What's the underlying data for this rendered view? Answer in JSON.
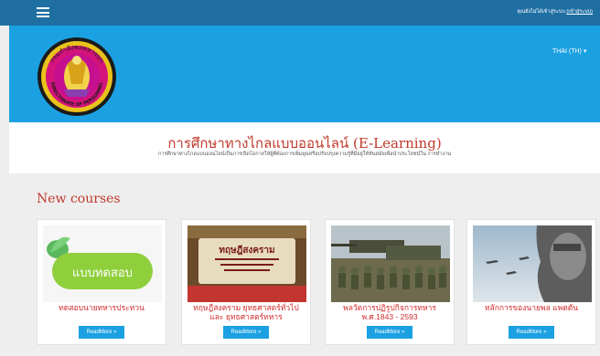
{
  "topbar": {
    "note": "คุณยังไม่ได้เข้าสู่ระบบ",
    "login_link": "(เข้าสู่ระบบ)"
  },
  "header": {
    "language": "THAI (TH) ▾",
    "logo_top_text": "กรมกำลังพลทหารบก",
    "logo_bottom_text": "DIRECTORATE OF PERSONNEL"
  },
  "banner": {
    "title": "การศึกษาทางไกลแบบออนไลน์ (E-Learning)",
    "subtitle": "การศึกษาทางไกลแบบออนไลน์เป็นการเปิดโอกาสให้ผู้ที่ต้องการเพิ่มพูนหรือปรับปรุงความรู้ที่มีอยู่ให้ทันสมัยเพื่อนำประโยชน์ใน การทำงาน"
  },
  "new_courses": {
    "heading": "New courses",
    "readmore_label": "ReadMore »",
    "courses": [
      {
        "title": "ทดสอบนายทหารประทวน",
        "thumb_text": "แบบทดสอบ"
      },
      {
        "title": "ทฤษฎีสงคราม ยุทธศาสตร์ทั่วไป และ ยุทธศาสตร์ทหาร",
        "thumb_text": "ทฤษฎีสงคราม"
      },
      {
        "title": "พลวัตการปฏิรูปกิจการทหาร พ.ศ.1843 - 2593",
        "thumb_text": ""
      },
      {
        "title": "หลักการของนายพล แพตตัน",
        "thumb_text": ""
      }
    ]
  },
  "colors": {
    "topbar": "#1f6fa3",
    "header": "#1ba1e2",
    "accent_red": "#c0392b",
    "button": "#1ba1e2"
  }
}
